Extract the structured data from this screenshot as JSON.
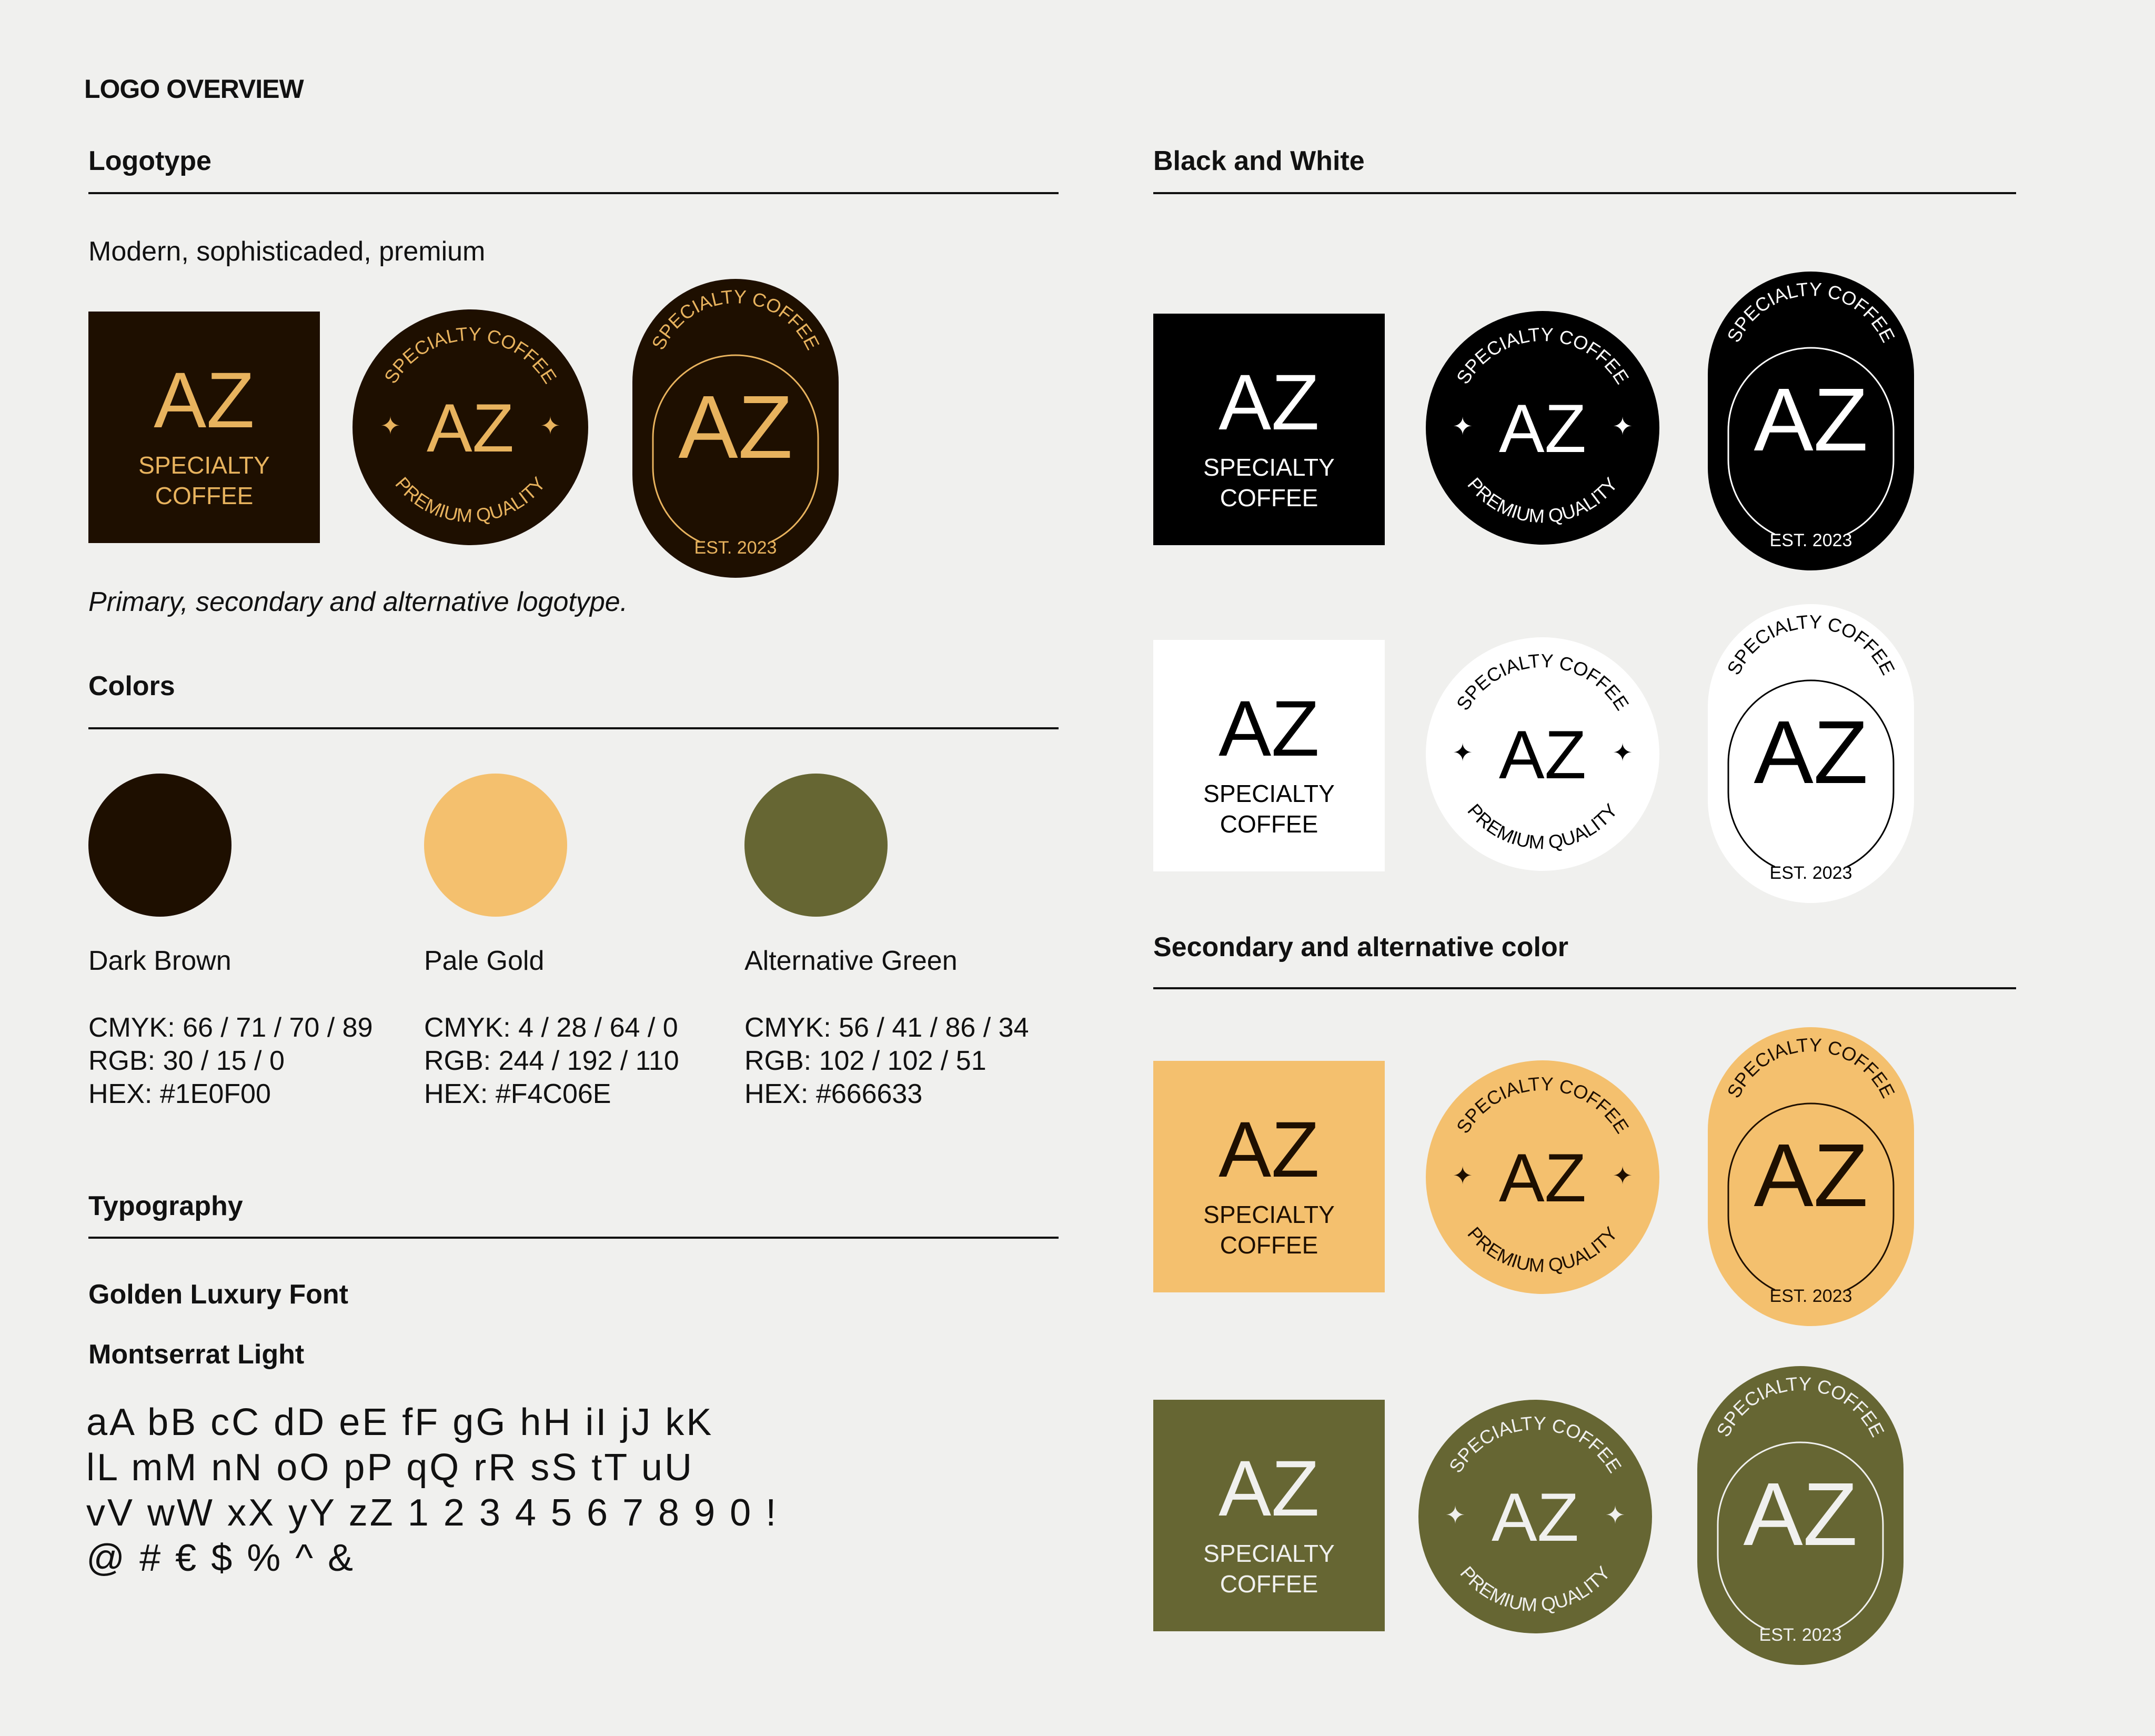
{
  "page_title": "LOGO OVERVIEW",
  "logotype": {
    "title": "Logotype",
    "description": "Modern, sophisticaded, premium",
    "caption": "Primary, secondary and alternative logotype."
  },
  "logo_text": {
    "monogram": "AZ",
    "specialty": "SPECIALTY",
    "coffee": "COFFEE",
    "arc_top": "SPECIALTY COFFEE",
    "arc_bottom": "PREMIUM QUALITY",
    "est": "EST. 2023",
    "star": "✦"
  },
  "colors": {
    "title": "Colors",
    "items": [
      {
        "name": "Dark Brown",
        "hex_color": "#1E0F00",
        "cmyk": "CMYK: 66 / 71 / 70 / 89",
        "rgb": "RGB: 30 / 15 / 0",
        "hex": "HEX: #1E0F00"
      },
      {
        "name": "Pale Gold",
        "hex_color": "#F4C06E",
        "cmyk": "CMYK: 4 / 28 / 64 / 0",
        "rgb": "RGB: 244 / 192 / 110",
        "hex": "HEX: #F4C06E"
      },
      {
        "name": "Alternative Green",
        "hex_color": "#666633",
        "cmyk": "CMYK: 56 / 41 / 86 / 34",
        "rgb": "RGB: 102 / 102 / 51",
        "hex": "HEX: #666633"
      }
    ]
  },
  "typography": {
    "title": "Typography",
    "font1": "Golden Luxury Font",
    "font2": "Montserrat Light",
    "glyph_lines": [
      "aA bB cC dD eE fF gG hH iI jJ kK",
      "lL mM nN oO pP qQ rR sS tT uU",
      "vV wW xX yY zZ 1 2 3 4 5 6 7 8 9 0 !",
      "@ # € $ % ^ &"
    ]
  },
  "bw": {
    "title": "Black and White"
  },
  "secondary": {
    "title": "Secondary and alternative color"
  },
  "palette": {
    "dark_brown": "#1E0F00",
    "logo_gold": "#E8B35E",
    "black": "#000000",
    "white": "#FFFFFF",
    "pale_gold": "#F4C06E",
    "green": "#666633",
    "page_bg": "#F0F0EE"
  }
}
